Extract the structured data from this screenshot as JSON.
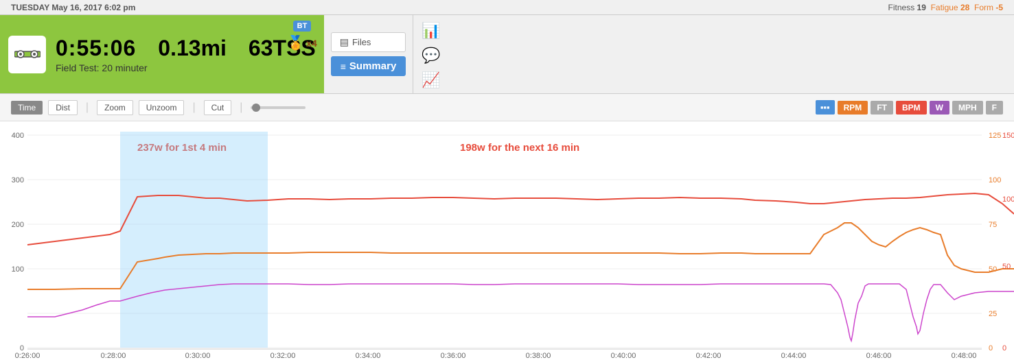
{
  "header": {
    "date": "TUESDAY  May 16, 2017  6:02 pm",
    "fitness_label": "Fitness",
    "fitness_value": "19",
    "fatigue_label": "Fatigue",
    "fatigue_value": "28",
    "form_label": "Form",
    "form_value": "-5",
    "activity": {
      "time": "0:55:06",
      "distance": "0.13mi",
      "tss": "63TSS",
      "label": "Field Test: 20 minuter",
      "badge_bt": "BT",
      "badge_medal": "x4"
    }
  },
  "toolbar": {
    "files_label": "Files",
    "summary_label": "Summary"
  },
  "controls": {
    "time_label": "Time",
    "dist_label": "Dist",
    "zoom_label": "Zoom",
    "unzoom_label": "Unzoom",
    "cut_label": "Cut"
  },
  "chart_toggles": {
    "bar": "◫",
    "rpm": "RPM",
    "ft": "FT",
    "bpm": "BPM",
    "w": "W",
    "mph": "MPH",
    "f": "F"
  },
  "annotations": {
    "left": "237w for 1st 4 min",
    "right": "198w for the next 16 min"
  },
  "y_axis_left": [
    "400",
    "300",
    "200",
    "100",
    "0"
  ],
  "y_axis_right1": [
    "125",
    "100",
    "75",
    "50",
    "25",
    "0"
  ],
  "y_axis_right2": [
    "150",
    "100",
    "50",
    "0"
  ],
  "x_axis": [
    "0:26:00",
    "0:28:00",
    "0:30:00",
    "0:32:00",
    "0:34:00",
    "0:36:00",
    "0:38:00",
    "0:40:00",
    "0:42:00",
    "0:44:00",
    "0:46:00",
    "0:48:00"
  ]
}
